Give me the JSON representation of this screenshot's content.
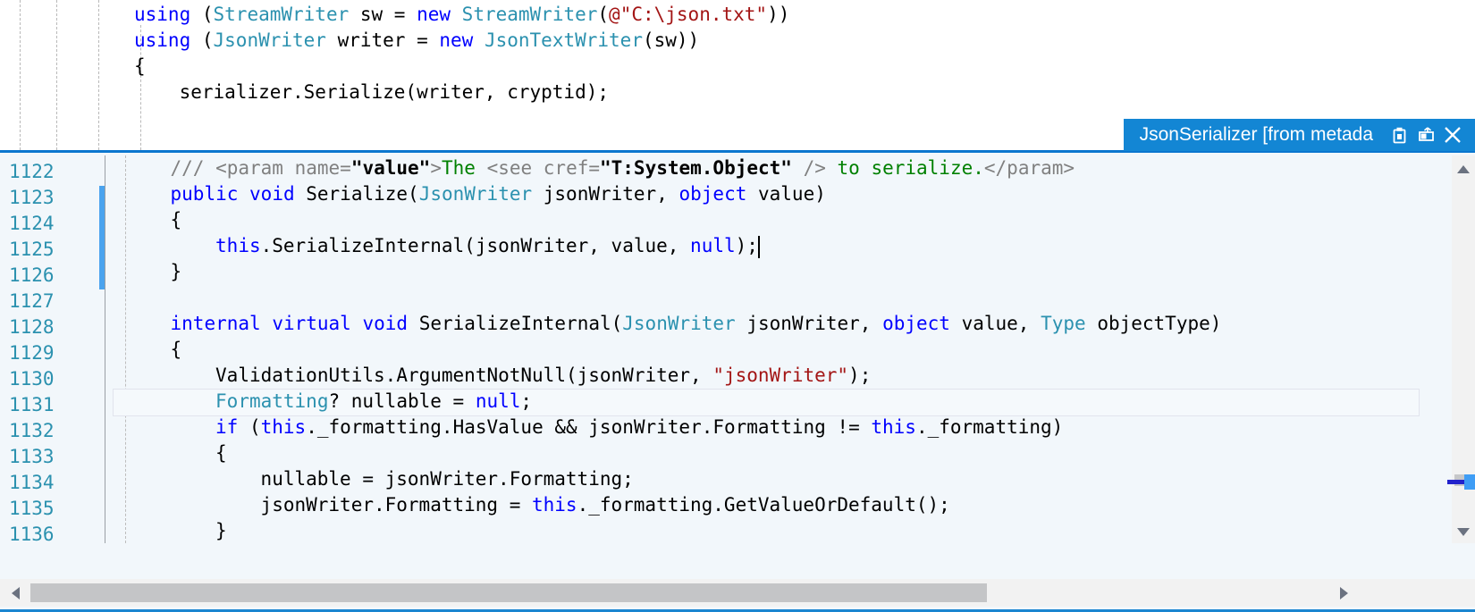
{
  "app": {
    "kind": "code-editor-peek-definition",
    "language": "C#"
  },
  "outer_editor": {
    "lines": [
      {
        "tokens": [
          {
            "t": "using ",
            "c": "k"
          },
          {
            "t": "(",
            "c": "n"
          },
          {
            "t": "StreamWriter",
            "c": "t"
          },
          {
            "t": " sw = ",
            "c": "n"
          },
          {
            "t": "new ",
            "c": "k"
          },
          {
            "t": "StreamWriter",
            "c": "t"
          },
          {
            "t": "(",
            "c": "n"
          },
          {
            "t": "@\"C:\\json.txt\"",
            "c": "s"
          },
          {
            "t": "))",
            "c": "n"
          }
        ]
      },
      {
        "tokens": [
          {
            "t": "using ",
            "c": "k"
          },
          {
            "t": "(",
            "c": "n"
          },
          {
            "t": "JsonWriter",
            "c": "t"
          },
          {
            "t": " writer = ",
            "c": "n"
          },
          {
            "t": "new ",
            "c": "k"
          },
          {
            "t": "JsonTextWriter",
            "c": "t"
          },
          {
            "t": "(sw))",
            "c": "n"
          }
        ]
      },
      {
        "tokens": [
          {
            "t": "{",
            "c": "n"
          }
        ]
      },
      {
        "tokens": [
          {
            "t": "    serializer.Serialize(writer, cryptid);",
            "c": "n"
          }
        ]
      }
    ]
  },
  "peek": {
    "title": "JsonSerializer [from metada",
    "title_bg": "#1386d4",
    "buttons": [
      {
        "name": "pin-icon",
        "label": "Pin"
      },
      {
        "name": "promote-to-document-icon",
        "label": "Promote to Document"
      },
      {
        "name": "close-icon",
        "label": "Close"
      }
    ],
    "accent_color": "#1386d4",
    "background": "#f2f7fb",
    "line_number_color": "#2b91af",
    "first_line_number": 1122,
    "changed_marker_color": "#4aa3ee",
    "lines": [
      {
        "num": "1122",
        "indent": 4,
        "tokens": [
          {
            "t": "/// ",
            "c": "c"
          },
          {
            "t": "<param name=",
            "c": "c"
          },
          {
            "t": "\"value\"",
            "c": "ca"
          },
          {
            "t": ">",
            "c": "c"
          },
          {
            "t": "The ",
            "c": "cg"
          },
          {
            "t": "<see cref=",
            "c": "c"
          },
          {
            "t": "\"T:System.Object\"",
            "c": "ca"
          },
          {
            "t": " />",
            "c": "c"
          },
          {
            "t": " to serialize.",
            "c": "cg"
          },
          {
            "t": "</param>",
            "c": "c"
          }
        ]
      },
      {
        "num": "1123",
        "indent": 4,
        "tokens": [
          {
            "t": "public ",
            "c": "k"
          },
          {
            "t": "void ",
            "c": "k"
          },
          {
            "t": "Serialize(",
            "c": "n"
          },
          {
            "t": "JsonWriter",
            "c": "t"
          },
          {
            "t": " jsonWriter, ",
            "c": "n"
          },
          {
            "t": "object",
            "c": "k"
          },
          {
            "t": " value)",
            "c": "n"
          }
        ]
      },
      {
        "num": "1124",
        "indent": 4,
        "tokens": [
          {
            "t": "{",
            "c": "n"
          }
        ]
      },
      {
        "num": "1125",
        "indent": 8,
        "tokens": [
          {
            "t": "this",
            "c": "k"
          },
          {
            "t": ".SerializeInternal(jsonWriter, value, ",
            "c": "n"
          },
          {
            "t": "null",
            "c": "k"
          },
          {
            "t": ");",
            "c": "n"
          }
        ]
      },
      {
        "num": "1126",
        "indent": 4,
        "tokens": [
          {
            "t": "}",
            "c": "n"
          }
        ]
      },
      {
        "num": "1127",
        "indent": 0,
        "tokens": [
          {
            "t": "",
            "c": "n"
          }
        ]
      },
      {
        "num": "1128",
        "indent": 4,
        "tokens": [
          {
            "t": "internal ",
            "c": "k"
          },
          {
            "t": "virtual ",
            "c": "k"
          },
          {
            "t": "void ",
            "c": "k"
          },
          {
            "t": "SerializeInternal(",
            "c": "n"
          },
          {
            "t": "JsonWriter",
            "c": "t"
          },
          {
            "t": " jsonWriter, ",
            "c": "n"
          },
          {
            "t": "object",
            "c": "k"
          },
          {
            "t": " value, ",
            "c": "n"
          },
          {
            "t": "Type",
            "c": "t"
          },
          {
            "t": " objectType)",
            "c": "n"
          }
        ]
      },
      {
        "num": "1129",
        "indent": 4,
        "tokens": [
          {
            "t": "{",
            "c": "n"
          }
        ]
      },
      {
        "num": "1130",
        "indent": 8,
        "tokens": [
          {
            "t": "ValidationUtils.ArgumentNotNull(jsonWriter, ",
            "c": "n"
          },
          {
            "t": "\"jsonWriter\"",
            "c": "s"
          },
          {
            "t": ");",
            "c": "n"
          }
        ]
      },
      {
        "num": "1131",
        "indent": 8,
        "tokens": [
          {
            "t": "Formatting",
            "c": "t"
          },
          {
            "t": "? nullable = ",
            "c": "n"
          },
          {
            "t": "null",
            "c": "k"
          },
          {
            "t": ";",
            "c": "n"
          }
        ]
      },
      {
        "num": "1132",
        "indent": 8,
        "tokens": [
          {
            "t": "if ",
            "c": "k"
          },
          {
            "t": "(",
            "c": "n"
          },
          {
            "t": "this",
            "c": "k"
          },
          {
            "t": "._formatting.HasValue && jsonWriter.Formatting != ",
            "c": "n"
          },
          {
            "t": "this",
            "c": "k"
          },
          {
            "t": "._formatting)",
            "c": "n"
          }
        ]
      },
      {
        "num": "1133",
        "indent": 8,
        "tokens": [
          {
            "t": "{",
            "c": "n"
          }
        ]
      },
      {
        "num": "1134",
        "indent": 12,
        "tokens": [
          {
            "t": "nullable = jsonWriter.Formatting;",
            "c": "n"
          }
        ]
      },
      {
        "num": "1135",
        "indent": 12,
        "tokens": [
          {
            "t": "jsonWriter.Formatting = ",
            "c": "n"
          },
          {
            "t": "this",
            "c": "k"
          },
          {
            "t": "._formatting.GetValueOrDefault();",
            "c": "n"
          }
        ]
      },
      {
        "num": "1136",
        "indent": 8,
        "tokens": [
          {
            "t": "}",
            "c": "n"
          }
        ]
      }
    ],
    "current_line": "1125",
    "scrollbars": {
      "vertical": {
        "name": "vertical-scrollbar"
      },
      "horizontal": {
        "name": "horizontal-scrollbar"
      }
    }
  }
}
